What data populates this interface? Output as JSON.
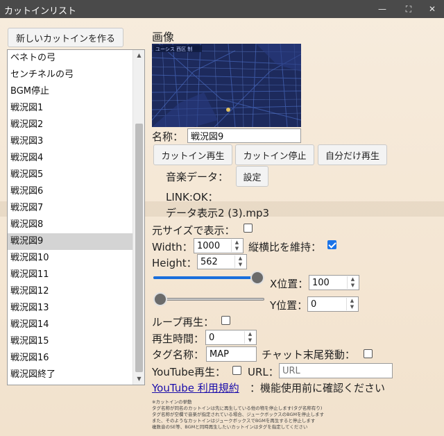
{
  "window": {
    "title": "カットインリスト"
  },
  "new_button": "新しいカットインを作る",
  "list": {
    "items": [
      "ベネトの弓",
      "センチネルの弓",
      "BGM停止",
      "戦況図1",
      "戦況図2",
      "戦況図3",
      "戦況図4",
      "戦況図5",
      "戦況図6",
      "戦況図7",
      "戦況図8",
      "戦況図9",
      "戦況図10",
      "戦況図11",
      "戦況図12",
      "戦況図13",
      "戦況図14",
      "戦況図15",
      "戦況図16",
      "戦況図終了"
    ],
    "selected": "戦況図9"
  },
  "image": {
    "label": "画像",
    "overlay_text": "ユーシス 西区 制"
  },
  "name": {
    "label": "名称：",
    "value": "戦況図9"
  },
  "buttons": {
    "play": "カットイン再生",
    "stop": "カットイン停止",
    "self_play": "自分だけ再生",
    "settings": "設定"
  },
  "music": {
    "label": "音楽データ：",
    "link": "LINK:OK：",
    "file": "データ表示2 (3).mp3"
  },
  "original_size": {
    "label": "元サイズで表示：",
    "checked": false
  },
  "width": {
    "label": "Width：",
    "value": "1000"
  },
  "aspect": {
    "label": "縦横比を維持：",
    "checked": true
  },
  "height": {
    "label": "Height：",
    "value": "562"
  },
  "x_pos": {
    "label": "X位置：",
    "value": "100",
    "slider_fraction": 1.0
  },
  "y_pos": {
    "label": "Y位置：",
    "value": "0",
    "slider_fraction": 0.0
  },
  "loop": {
    "label": "ループ再生：",
    "checked": false
  },
  "play_time": {
    "label": "再生時間：",
    "value": "0"
  },
  "tag": {
    "label": "タグ名称：",
    "value": "MAP"
  },
  "chat_end": {
    "label": "チャット末尾発動：",
    "checked": false
  },
  "youtube": {
    "label": "YouTube再生：",
    "checked": false
  },
  "url": {
    "label": "URL：",
    "placeholder": "URL"
  },
  "youtube_terms": {
    "link": "YouTube 利用規約",
    "note": "：機能使用前に確認ください"
  },
  "notes": [
    "※カットインの挙動",
    "タグ名称が同名のカットインは先に再生している他の物を停止します(タグ名称有り)",
    "タグ名称が空欄で音楽が指定されている場合、ジュークボックスのBGMを停止します",
    "また、そのようなカットインはジュークボックスでBGMを再生すると停止します",
    "複数音のSE等、BGMと同時再生したいカットインはタグを指定してください"
  ],
  "colors": {
    "titlebar": "#4a4a4a",
    "selected_row": "#d4d4d4",
    "slider_fill": "#1a6fdc",
    "checkbox_on": "#1a73e8",
    "link": "#1a0dab"
  }
}
